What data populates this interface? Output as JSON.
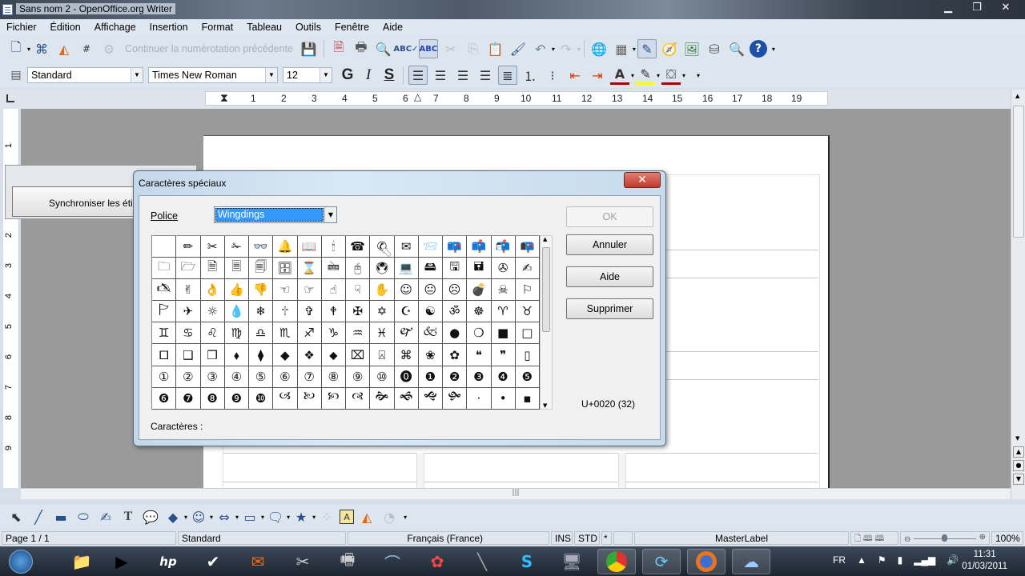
{
  "window": {
    "title": "Sans nom 2 - OpenOffice.org Writer",
    "controls": [
      "minimize",
      "restore",
      "close"
    ]
  },
  "menu": [
    "Fichier",
    "Édition",
    "Affichage",
    "Insertion",
    "Format",
    "Tableau",
    "Outils",
    "Fenêtre",
    "Aide"
  ],
  "toolbar1": {
    "continue_numbering": "Continuer la numérotation précédente",
    "icons": [
      "new-document-icon",
      "fields-icon",
      "shapes-icon",
      "page-number-icon",
      "save-icon",
      "export-pdf-icon",
      "print-icon",
      "page-preview-icon",
      "spellcheck-icon",
      "autospellcheck-icon",
      "cut-icon",
      "copy-icon",
      "paste-icon",
      "format-paintbrush-icon",
      "undo-icon",
      "redo-icon",
      "hyperlink-icon",
      "table-icon",
      "draw-functions-icon",
      "navigator-icon",
      "gallery-icon",
      "data-sources-icon",
      "zoom-icon",
      "help-icon"
    ]
  },
  "toolbar2": {
    "style": "Standard",
    "font": "Times New Roman",
    "size": "12",
    "bold": "G",
    "italic": "I",
    "underline": "S"
  },
  "ruler": {
    "marks": [
      "1",
      "2",
      "3",
      "4",
      "5",
      "6",
      "7",
      "8",
      "9",
      "10",
      "11",
      "12",
      "13",
      "14",
      "15",
      "16",
      "17",
      "18",
      "19"
    ]
  },
  "vruler": {
    "marks": [
      "1",
      "2",
      "3",
      "4",
      "5",
      "6",
      "7",
      "8",
      "9"
    ]
  },
  "background_dialog": {
    "button": "Synchroniser les étiquettes"
  },
  "dialog": {
    "title": "Caractères spéciaux",
    "font_label": "Police",
    "font_value": "Wingdings",
    "buttons": {
      "ok": "OK",
      "cancel": "Annuler",
      "help": "Aide",
      "delete": "Supprimer"
    },
    "unicode_readout": "U+0020 (32)",
    "characters_label": "Caractères :",
    "grid": [
      [
        " ",
        "✏",
        "✂",
        "✁",
        "👓",
        "🔔",
        "📖",
        "🕯",
        "☎",
        "✆",
        "✉",
        "📨",
        "📪",
        "📫",
        "📬",
        "📭"
      ],
      [
        "🗀",
        "🗁",
        "🗎",
        "🗏",
        "🗐",
        "🗄",
        "⌛",
        "🖮",
        "🖰",
        "🖲",
        "💻",
        "🖴",
        "🖫",
        "🖬",
        "✇",
        "✍"
      ],
      [
        "🖎",
        "✌",
        "👌",
        "👍",
        "👎",
        "☜",
        "☞",
        "☝",
        "☟",
        "✋",
        "☺",
        "😐",
        "☹",
        "💣",
        "☠",
        "⚐"
      ],
      [
        "🏱",
        "✈",
        "☼",
        "💧",
        "❄",
        "🕆",
        "✞",
        "🕈",
        "✠",
        "✡",
        "☪",
        "☯",
        "ॐ",
        "☸",
        "♈",
        "♉"
      ],
      [
        "♊",
        "♋",
        "♌",
        "♍",
        "♎",
        "♏",
        "♐",
        "♑",
        "♒",
        "♓",
        "🙰",
        "🙵",
        "●",
        "❍",
        "■",
        "□"
      ],
      [
        "🞐",
        "❑",
        "❒",
        "⬧",
        "⧫",
        "◆",
        "❖",
        "⬥",
        "⌧",
        "⍓",
        "⌘",
        "❀",
        "✿",
        "❝",
        "❞",
        "▯"
      ],
      [
        "①",
        "②",
        "③",
        "④",
        "⑤",
        "⑥",
        "⑦",
        "⑧",
        "⑨",
        "⑩",
        "⓿",
        "❶",
        "❷",
        "❸",
        "❹",
        "❺"
      ],
      [
        "❻",
        "❼",
        "❽",
        "❾",
        "❿",
        "🙢",
        "🙠",
        "🙡",
        "🙣",
        "🙞",
        "🙜",
        "🙝",
        "🙟",
        "·",
        "•",
        "▪"
      ]
    ]
  },
  "drawbar": {
    "icons": [
      "select-icon",
      "line-icon",
      "rectangle-icon",
      "ellipse-icon",
      "freeform-icon",
      "text-icon",
      "callout-icon",
      "basic-shapes-icon",
      "symbol-shapes-icon",
      "block-arrows-icon",
      "flowchart-icon",
      "callouts-icon",
      "stars-icon",
      "points-icon",
      "fontwork-icon",
      "from-file-icon",
      "extrusion-icon"
    ]
  },
  "status": {
    "page": "Page 1 / 1",
    "style": "Standard",
    "language": "Français (France)",
    "insert_mode": "INS",
    "selection_mode": "STD",
    "modified": "*",
    "master": "MasterLabel",
    "zoom": "100%",
    "zoom_level": 100
  },
  "taskbar": {
    "apps": [
      "start",
      "explorer",
      "media-player",
      "hp",
      "check-app",
      "mail",
      "snipping-tool",
      "fax-scanner",
      "scanner",
      "picasa",
      "pen-tool",
      "skype",
      "remote-desktop",
      "chrome",
      "sync-app",
      "firefox",
      "openoffice"
    ],
    "language": "FR",
    "time": "11:31",
    "date": "01/03/2011"
  }
}
